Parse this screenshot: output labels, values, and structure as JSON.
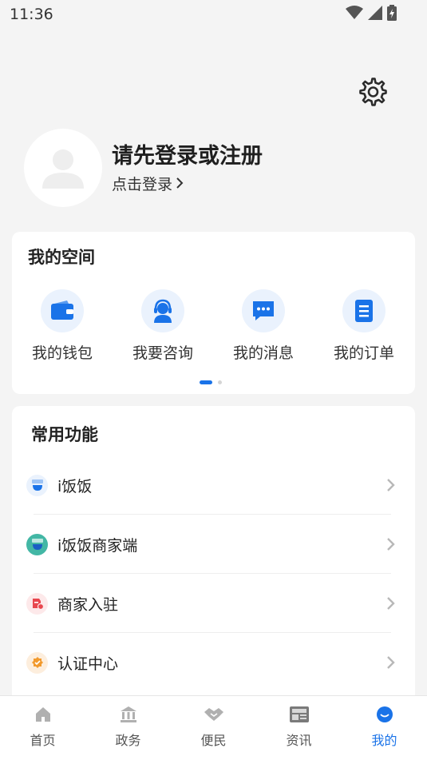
{
  "status_bar": {
    "time": "11:36"
  },
  "profile": {
    "title": "请先登录或注册",
    "link": "点击登录"
  },
  "my_space": {
    "title": "我的空间",
    "items": [
      {
        "label": "我的钱包",
        "icon": "wallet-icon"
      },
      {
        "label": "我要咨询",
        "icon": "consult-icon"
      },
      {
        "label": "我的消息",
        "icon": "message-icon"
      },
      {
        "label": "我的订单",
        "icon": "order-icon"
      }
    ]
  },
  "common_functions": {
    "title": "常用功能",
    "items": [
      {
        "label": "i饭饭",
        "icon": "ifanfan-icon"
      },
      {
        "label": "i饭饭商家端",
        "icon": "ifanfan-merchant-icon"
      },
      {
        "label": "商家入驻",
        "icon": "merchant-join-icon"
      },
      {
        "label": "认证中心",
        "icon": "certification-icon"
      }
    ]
  },
  "tabbar": {
    "tabs": [
      {
        "label": "首页",
        "icon": "home-icon"
      },
      {
        "label": "政务",
        "icon": "government-icon"
      },
      {
        "label": "便民",
        "icon": "handshake-icon"
      },
      {
        "label": "资讯",
        "icon": "news-icon"
      },
      {
        "label": "我的",
        "icon": "profile-icon"
      }
    ],
    "active_index": 4
  },
  "colors": {
    "accent": "#1a73e8",
    "background": "#f4f4f4"
  }
}
